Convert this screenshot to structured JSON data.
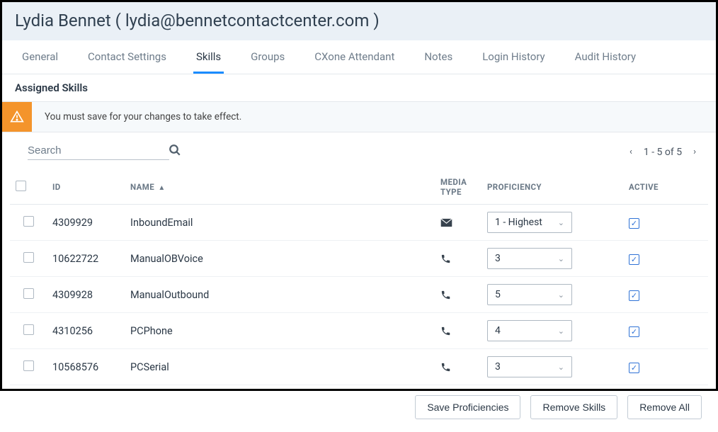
{
  "title": "Lydia Bennet ( lydia@bennetcontactcenter.com )",
  "tabs": [
    "General",
    "Contact Settings",
    "Skills",
    "Groups",
    "CXone Attendant",
    "Notes",
    "Login History",
    "Audit History"
  ],
  "active_tab_index": 2,
  "section_title": "Assigned Skills",
  "alert": "You must save for your changes to take effect.",
  "search": {
    "placeholder": "Search"
  },
  "pager": {
    "text": "1 - 5 of 5"
  },
  "columns": {
    "id": "ID",
    "name": "NAME",
    "media": "MEDIA TYPE",
    "proficiency": "PROFICIENCY",
    "active": "ACTIVE"
  },
  "rows": [
    {
      "id": "4309929",
      "name": "InboundEmail",
      "media": "email",
      "proficiency": "1 - Highest",
      "active": true
    },
    {
      "id": "10622722",
      "name": "ManualOBVoice",
      "media": "phone",
      "proficiency": "3",
      "active": true
    },
    {
      "id": "4309928",
      "name": "ManualOutbound",
      "media": "phone",
      "proficiency": "5",
      "active": true
    },
    {
      "id": "4310256",
      "name": "PCPhone",
      "media": "phone",
      "proficiency": "4",
      "active": true
    },
    {
      "id": "10568576",
      "name": "PCSerial",
      "media": "phone",
      "proficiency": "3",
      "active": true
    }
  ],
  "buttons": {
    "save": "Save Proficiencies",
    "remove": "Remove Skills",
    "remove_all": "Remove All"
  }
}
